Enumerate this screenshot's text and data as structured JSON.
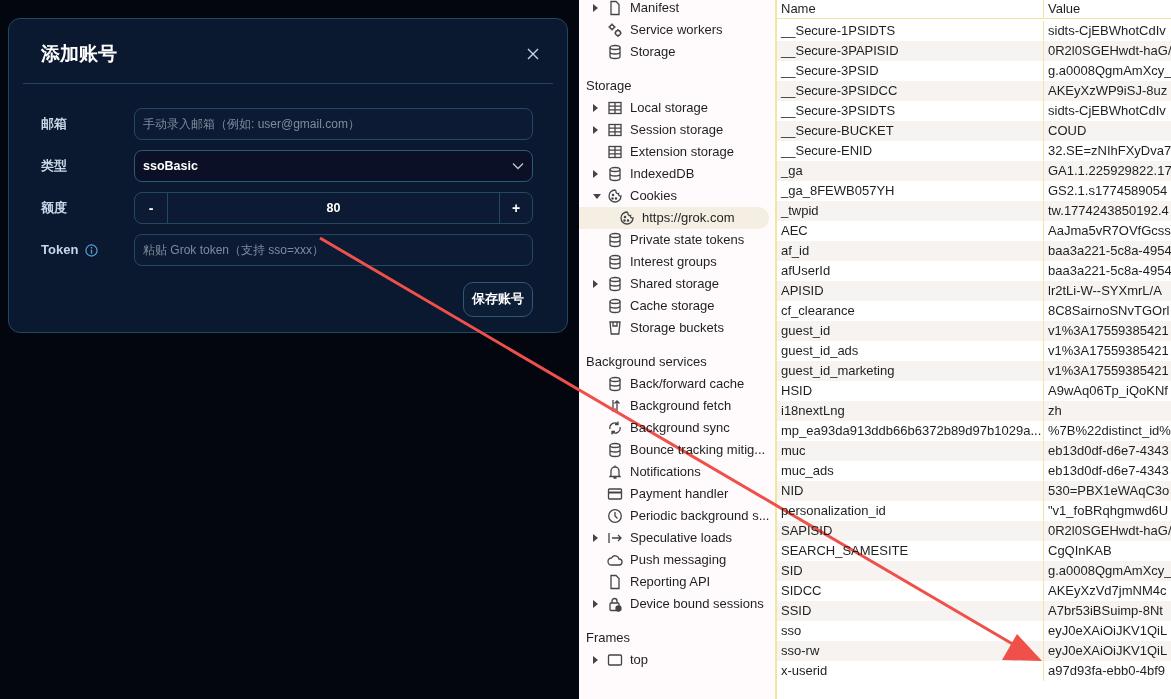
{
  "dialog": {
    "title": "添加账号",
    "fields": [
      {
        "kind": "text",
        "label": "邮箱",
        "placeholder": "手动录入邮箱（例如: user@gmail.com）"
      },
      {
        "kind": "select",
        "label": "类型",
        "value": "ssoBasic"
      },
      {
        "kind": "stepper",
        "label": "额度",
        "value": "80",
        "minus": "-",
        "plus": "+"
      },
      {
        "kind": "text",
        "label": "Token",
        "info": true,
        "placeholder": "粘贴 Grok token（支持 sso=xxx）"
      }
    ],
    "save_button": "保存账号"
  },
  "sidebar": {
    "sections": [
      {
        "items": [
          {
            "label": "Manifest",
            "expanded": false,
            "selected": false
          },
          {
            "label": "Service workers",
            "selected": false
          },
          {
            "label": "Storage",
            "selected": false
          }
        ]
      },
      {
        "heading": "Storage",
        "items": [
          {
            "label": "Local storage",
            "expanded": false,
            "selected": false
          },
          {
            "label": "Session storage",
            "expanded": false,
            "selected": false
          },
          {
            "label": "Extension storage",
            "selected": false
          },
          {
            "label": "IndexedDB",
            "expanded": false,
            "selected": false
          },
          {
            "label": "Cookies",
            "expanded": true,
            "selected": false,
            "children": [
              {
                "label": "https://grok.com",
                "selected": true
              }
            ]
          },
          {
            "label": "Private state tokens",
            "selected": false
          },
          {
            "label": "Interest groups",
            "selected": false
          },
          {
            "label": "Shared storage",
            "expanded": false,
            "selected": false
          },
          {
            "label": "Cache storage",
            "selected": false
          },
          {
            "label": "Storage buckets",
            "selected": false
          }
        ]
      },
      {
        "heading": "Background services",
        "items": [
          {
            "label": "Back/forward cache",
            "selected": false
          },
          {
            "label": "Background fetch",
            "selected": false
          },
          {
            "label": "Background sync",
            "selected": false
          },
          {
            "label": "Bounce tracking mitig...",
            "selected": false
          },
          {
            "label": "Notifications",
            "selected": false
          },
          {
            "label": "Payment handler",
            "selected": false
          },
          {
            "label": "Periodic background s...",
            "selected": false
          },
          {
            "label": "Speculative loads",
            "expanded": false,
            "selected": false
          },
          {
            "label": "Push messaging",
            "selected": false
          },
          {
            "label": "Reporting API",
            "selected": false
          },
          {
            "label": "Device bound sessions",
            "expanded": false,
            "selected": false
          }
        ]
      },
      {
        "heading": "Frames",
        "items": [
          {
            "label": "top",
            "expanded": false,
            "selected": false
          }
        ]
      }
    ]
  },
  "table": {
    "columns": [
      "Name",
      "Value"
    ],
    "rows": [
      [
        "__Secure-1PSIDTS",
        "sidts-CjEBWhotCdIv"
      ],
      [
        "__Secure-3PAPISID",
        "0R2l0SGEHwdt-haG/"
      ],
      [
        "__Secure-3PSID",
        "g.a0008QgmAmXcy_"
      ],
      [
        "__Secure-3PSIDCC",
        "AKEyXzWP9iSJ-8uz"
      ],
      [
        "__Secure-3PSIDTS",
        "sidts-CjEBWhotCdIv"
      ],
      [
        "__Secure-BUCKET",
        "COUD"
      ],
      [
        "__Secure-ENID",
        "32.SE=zNIhFXyDva7"
      ],
      [
        "_ga",
        "GA1.1.225929822.17"
      ],
      [
        "_ga_8FEWB057YH",
        "GS2.1.s1774589054"
      ],
      [
        "_twpid",
        "tw.1774243850192.4"
      ],
      [
        "AEC",
        "AaJma5vR7OVfGcss"
      ],
      [
        "af_id",
        "baa3a221-5c8a-4954"
      ],
      [
        "afUserId",
        "baa3a221-5c8a-4954"
      ],
      [
        "APISID",
        "lr2tLi-W--SYXmrL/A"
      ],
      [
        "cf_clearance",
        "8C8SairnoSNvTGOrl"
      ],
      [
        "guest_id",
        "v1%3A17559385421"
      ],
      [
        "guest_id_ads",
        "v1%3A17559385421"
      ],
      [
        "guest_id_marketing",
        "v1%3A17559385421"
      ],
      [
        "HSID",
        "A9wAq06Tp_iQoKNf"
      ],
      [
        "i18nextLng",
        "zh"
      ],
      [
        "mp_ea93da913ddb66b6372b89d97b1029a...",
        "%7B%22distinct_id%"
      ],
      [
        "muc",
        "eb13d0df-d6e7-4343"
      ],
      [
        "muc_ads",
        "eb13d0df-d6e7-4343"
      ],
      [
        "NID",
        "530=PBX1eWAqC3o"
      ],
      [
        "personalization_id",
        "\"v1_foBRqhgmwd6U"
      ],
      [
        "SAPISID",
        "0R2l0SGEHwdt-haG/"
      ],
      [
        "SEARCH_SAMESITE",
        "CgQInKAB"
      ],
      [
        "SID",
        "g.a0008QgmAmXcy_"
      ],
      [
        "SIDCC",
        "AKEyXzVd7jmNM4c"
      ],
      [
        "SSID",
        "A7br53iBSuimp-8Nt"
      ],
      [
        "sso",
        "eyJ0eXAiOiJKV1QiL"
      ],
      [
        "sso-rw",
        "eyJ0eXAiOiJKV1QiL"
      ],
      [
        "x-userid",
        "a97d93fa-ebb0-4bf9"
      ]
    ]
  }
}
